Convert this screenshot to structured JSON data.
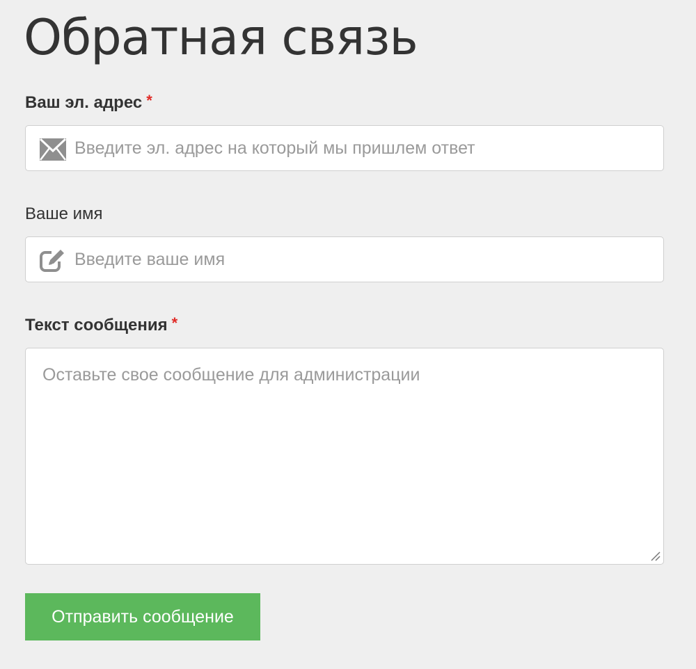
{
  "page": {
    "title": "Обратная связь"
  },
  "form": {
    "email": {
      "label": "Ваш эл. адрес",
      "required_mark": "*",
      "placeholder": "Введите эл. адрес на который мы пришлем ответ",
      "value": "",
      "icon": "envelope-icon"
    },
    "name": {
      "label": "Ваше имя",
      "placeholder": "Введите ваше имя",
      "value": "",
      "icon": "edit-icon"
    },
    "message": {
      "label": "Текст сообщения",
      "required_mark": "*",
      "placeholder": "Оставьте свое сообщение для администрации",
      "value": ""
    },
    "submit_label": "Отправить сообщение"
  },
  "colors": {
    "background": "#efefef",
    "required": "#e02b27",
    "button": "#5cb85c",
    "placeholder": "#9a9a9a",
    "icon": "#8f8f8f"
  }
}
